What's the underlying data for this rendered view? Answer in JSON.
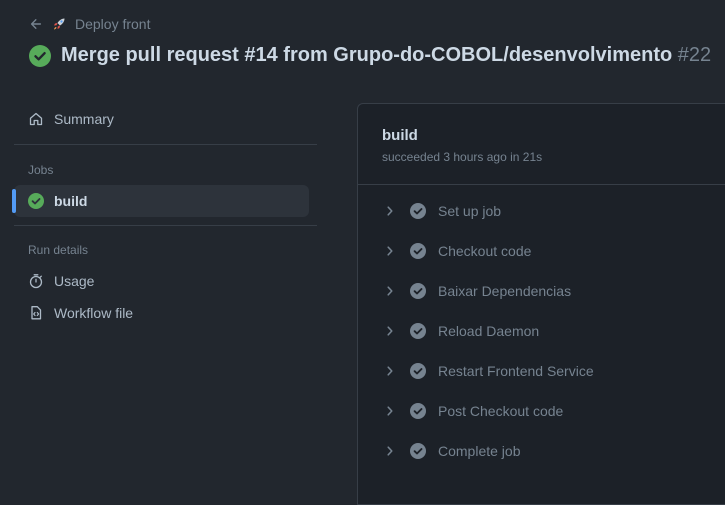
{
  "header": {
    "back_icon": "arrow-left-icon",
    "rocket_icon": "rocket-icon",
    "workflow_name": "Deploy front",
    "title": "Merge pull request #14 from Grupo-do-COBOL/desenvolvimento",
    "run_number": "#22",
    "status": "success"
  },
  "sidebar": {
    "summary_label": "Summary",
    "jobs_heading": "Jobs",
    "job_label": "build",
    "run_details_heading": "Run details",
    "usage_label": "Usage",
    "workflow_file_label": "Workflow file"
  },
  "job": {
    "name": "build",
    "status_line": "succeeded 3 hours ago in 21s",
    "steps": [
      {
        "label": "Set up job"
      },
      {
        "label": "Checkout code"
      },
      {
        "label": "Baixar Dependencias"
      },
      {
        "label": "Reload Daemon"
      },
      {
        "label": "Restart Frontend Service"
      },
      {
        "label": "Post Checkout code"
      },
      {
        "label": "Complete job"
      }
    ]
  },
  "colors": {
    "background": "#22272e",
    "panel": "#1c2128",
    "success": "#57ab5a",
    "accent": "#539bf5",
    "muted": "#768390"
  }
}
